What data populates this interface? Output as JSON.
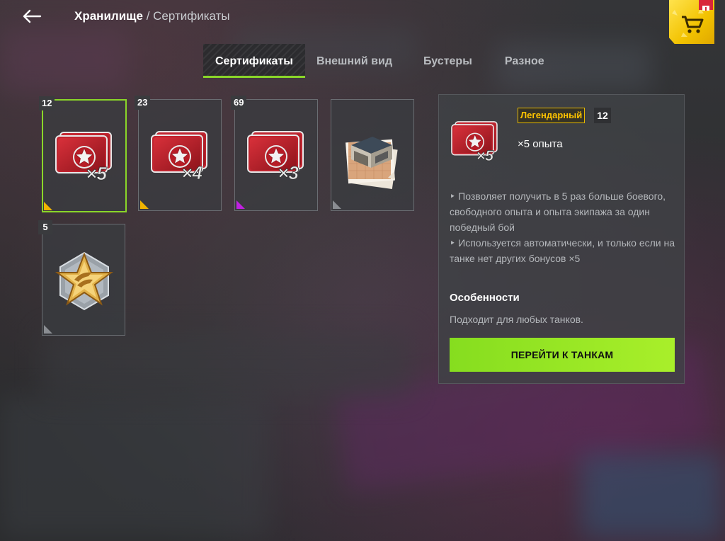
{
  "header": {
    "title": "Хранилище",
    "separator": "/",
    "subtitle": "Сертификаты"
  },
  "tabs": [
    {
      "label": "Сертификаты",
      "active": true
    },
    {
      "label": "Внешний вид",
      "active": false
    },
    {
      "label": "Бустеры",
      "active": false
    },
    {
      "label": "Разное",
      "active": false
    }
  ],
  "items": [
    {
      "count": "12",
      "icon": "xp-cards-x5-icon",
      "mark": "×5",
      "rarity_color": "#f0b400",
      "selected": true
    },
    {
      "count": "23",
      "icon": "xp-cards-x4-icon",
      "mark": "×4",
      "rarity_color": "#f0b400",
      "selected": false
    },
    {
      "count": "69",
      "icon": "xp-cards-x3-icon",
      "mark": "×3",
      "rarity_color": "#c020e0",
      "selected": false
    },
    {
      "count": "",
      "icon": "garage-slot-icon",
      "mark": "",
      "rarity_color": "#8a8d92",
      "selected": false
    },
    {
      "count": "5",
      "icon": "commander-badge-icon",
      "mark": "",
      "rarity_color": "#8a8d92",
      "selected": false
    }
  ],
  "details": {
    "mark": "×5",
    "rarity": "Легендарный",
    "count": "12",
    "name": "×5 опыта",
    "desc1": "‣ Позволяет получить в 5 раз больше боевого, свободного опыта и опыта экипажа за один победный бой",
    "desc2": "‣ Используется автоматически, и только если на танке нет других бонусов ×5",
    "features_title": "Особенности",
    "features_text": "Подходит для любых танков.",
    "button": "ПЕРЕЙТИ К ТАНКАМ"
  },
  "colors": {
    "accent": "#8ad629",
    "legendary": "#ffc400",
    "epic": "#c020e0",
    "common": "#8a8d92"
  }
}
